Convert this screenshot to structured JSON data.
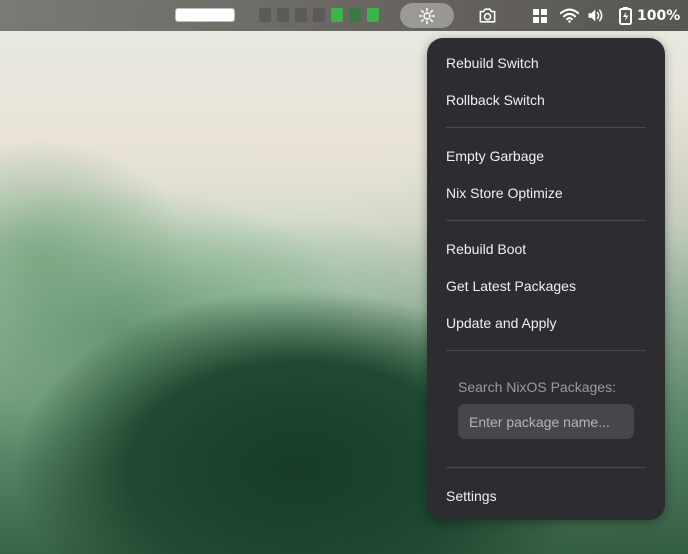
{
  "topbar": {
    "battery_percent": "100%",
    "workspaces": [
      {
        "active": false,
        "color": "#5a5a57"
      },
      {
        "active": false,
        "color": "#5a5a57"
      },
      {
        "active": false,
        "color": "#5a5a57"
      },
      {
        "active": false,
        "color": "#5a5a57"
      },
      {
        "active": true,
        "color": "#3bb44a"
      },
      {
        "active": false,
        "color": "#3a7a44"
      },
      {
        "active": true,
        "color": "#3bb44a"
      }
    ],
    "icons": {
      "indicator": "gear-icon",
      "screenshot": "camera-icon",
      "grid": "grid-icon",
      "wifi": "wifi-icon",
      "volume": "volume-icon",
      "battery": "battery-icon"
    }
  },
  "menu": {
    "items": {
      "rebuild_switch": "Rebuild Switch",
      "rollback_switch": "Rollback Switch",
      "empty_garbage": "Empty Garbage",
      "nix_store_optimize": "Nix Store Optimize",
      "rebuild_boot": "Rebuild Boot",
      "get_latest_packages": "Get Latest Packages",
      "update_and_apply": "Update and Apply",
      "settings": "Settings"
    },
    "search": {
      "label": "Search NixOS Packages:",
      "placeholder": "Enter package name...",
      "value": ""
    }
  },
  "colors": {
    "menu_bg": "#2d2c30",
    "menu_text": "#f0f0f0",
    "muted_text": "#9b9aa0",
    "input_bg": "#47464c",
    "workspace_active": "#3bb44a"
  }
}
